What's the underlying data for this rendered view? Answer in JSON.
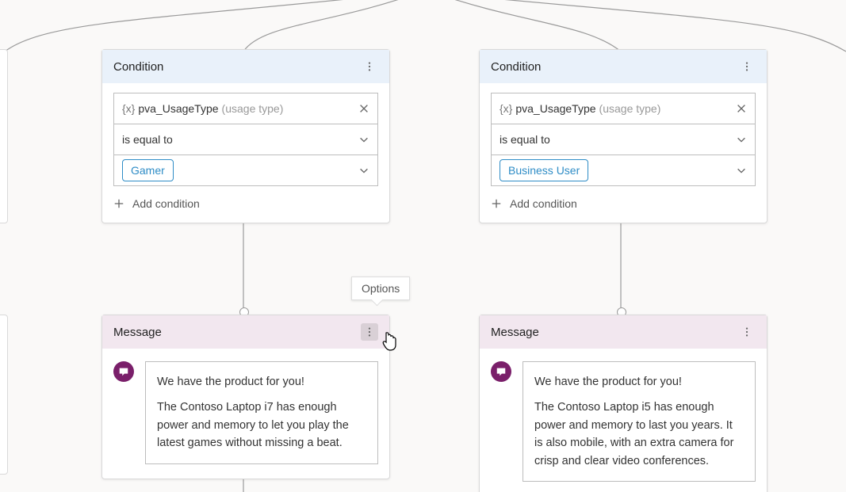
{
  "tooltip": "Options",
  "branches": [
    {
      "condition": {
        "title": "Condition",
        "variable": {
          "prefix": "{x}",
          "name": "pva_UsageType",
          "type": "(usage type)"
        },
        "operator": "is equal to",
        "value": "Gamer",
        "add_label": "Add condition"
      },
      "message": {
        "title": "Message",
        "lines": [
          "We have the product for you!",
          "The Contoso Laptop i7 has enough power and memory to let you play the latest games without missing a beat."
        ]
      }
    },
    {
      "condition": {
        "title": "Condition",
        "variable": {
          "prefix": "{x}",
          "name": "pva_UsageType",
          "type": "(usage type)"
        },
        "operator": "is equal to",
        "value": "Business User",
        "add_label": "Add condition"
      },
      "message": {
        "title": "Message",
        "lines": [
          "We have the product for you!",
          "The Contoso Laptop i5 has enough power and memory to last you years. It is also mobile, with an extra camera for crisp and clear video conferences."
        ]
      }
    }
  ]
}
